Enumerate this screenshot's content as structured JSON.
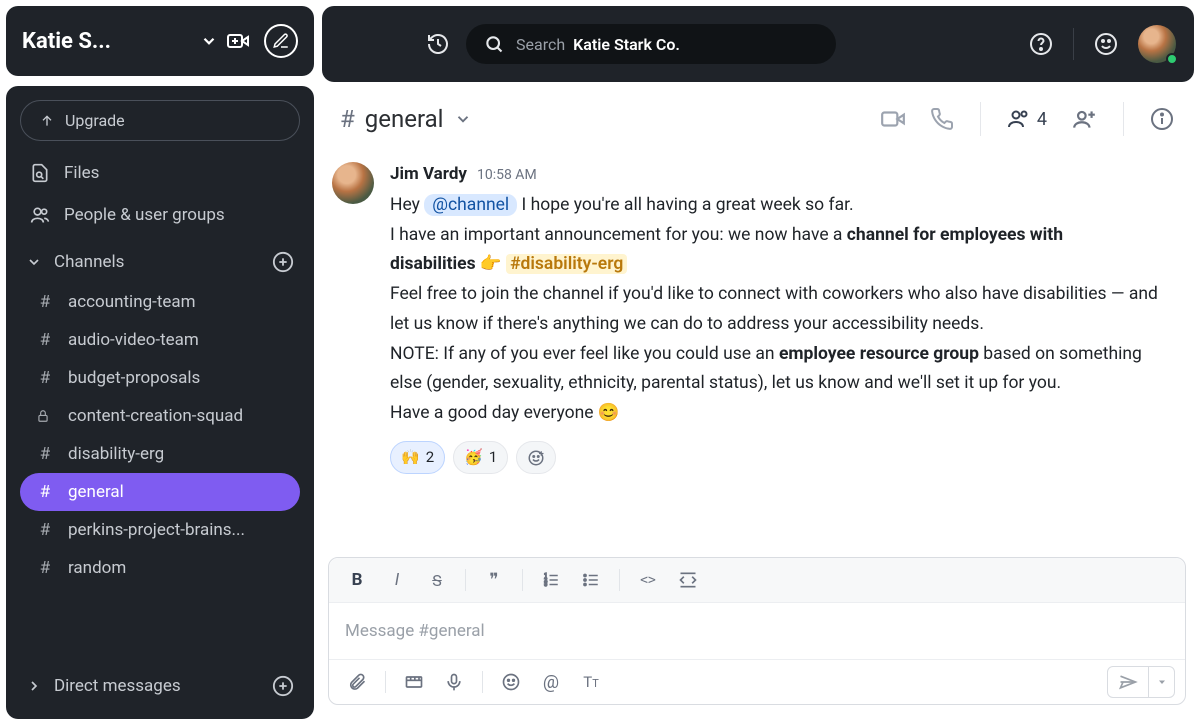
{
  "workspace": {
    "name": "Katie S..."
  },
  "sidebar": {
    "upgrade": "Upgrade",
    "files": "Files",
    "people": "People & user groups",
    "channels_label": "Channels",
    "dm_label": "Direct messages",
    "channels": [
      {
        "name": "accounting-team",
        "locked": false
      },
      {
        "name": "audio-video-team",
        "locked": false
      },
      {
        "name": "budget-proposals",
        "locked": false
      },
      {
        "name": "content-creation-squad",
        "locked": true
      },
      {
        "name": "disability-erg",
        "locked": false
      },
      {
        "name": "general",
        "locked": false,
        "active": true
      },
      {
        "name": "perkins-project-brains...",
        "locked": false
      },
      {
        "name": "random",
        "locked": false
      }
    ]
  },
  "search": {
    "label": "Search",
    "context": "Katie Stark Co."
  },
  "channel_header": {
    "name": "general",
    "members": "4"
  },
  "message": {
    "author": "Jim Vardy",
    "time": "10:58 AM",
    "greeting_pre": "Hey ",
    "mention": "@channel",
    "greeting_post": "  I hope you're all having a great week so far.",
    "line2_pre": "I have an important announcement for you: we now have a ",
    "line2_bold": "channel for employees with disabilities",
    "pointer_emoji": "👉",
    "chlink": "#disability-erg",
    "line3": "Feel free to join the channel if you'd like to connect with coworkers who also have disabilities — and let us know if there's anything we can do to address your accessibility needs.",
    "line4_pre": "NOTE: If any of you ever feel like you could use an ",
    "line4_bold": "employee resource group",
    "line4_post": " based on something else (gender, sexuality, ethnicity, parental status), let us know and we'll set it up for you.",
    "line5": "Have a good day everyone ",
    "smile": "😊",
    "reactions": [
      {
        "emoji": "🙌",
        "count": "2"
      },
      {
        "emoji": "🥳",
        "count": "1"
      }
    ]
  },
  "composer": {
    "placeholder": "Message #general"
  }
}
